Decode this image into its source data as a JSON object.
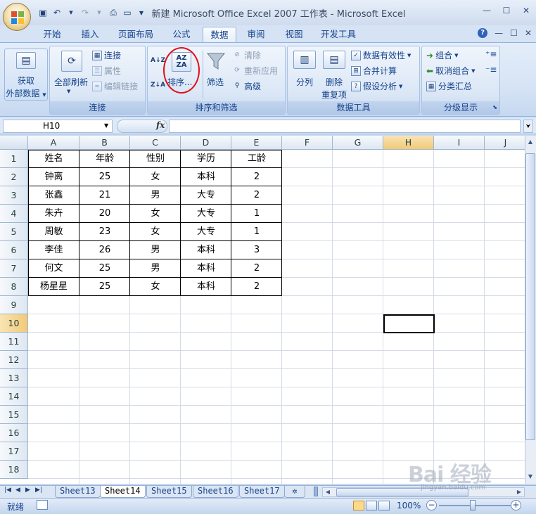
{
  "window": {
    "title": "新建 Microsoft Office Excel 2007 工作表 - Microsoft Excel",
    "minimize": "—",
    "maximize": "☐",
    "close": "✕"
  },
  "qat": [
    "save-icon",
    "undo-icon",
    "redo-icon",
    "print-preview-icon",
    "new-icon",
    "customize-icon"
  ],
  "tabs": [
    "开始",
    "插入",
    "页面布局",
    "公式",
    "数据",
    "审阅",
    "视图",
    "开发工具"
  ],
  "active_tab": "数据",
  "mdi": {
    "help": "?",
    "minimize": "—",
    "restore": "☐",
    "close": "✕"
  },
  "ribbon": {
    "get_external": {
      "label1": "获取",
      "label2": "外部数据"
    },
    "connections": {
      "refresh_all": "全部刷新",
      "connections": "连接",
      "properties": "属性",
      "edit_links": "编辑链接",
      "group_label": "连接"
    },
    "sort_filter": {
      "sort_az": "A↓Z",
      "sort_za": "Z↓A",
      "sort": "排序...",
      "filter": "筛选",
      "clear": "清除",
      "reapply": "重新应用",
      "advanced": "高级",
      "group_label": "排序和筛选"
    },
    "data_tools": {
      "text_to_columns": "分列",
      "remove_dup1": "删除",
      "remove_dup2": "重复项",
      "validation": "数据有效性",
      "consolidate": "合并计算",
      "whatif": "假设分析",
      "group_label": "数据工具"
    },
    "outline": {
      "group": "组合",
      "ungroup": "取消组合",
      "subtotal": "分类汇总",
      "group_label": "分级显示"
    }
  },
  "formula_bar": {
    "name_box": "H10",
    "fx": "fx",
    "formula": ""
  },
  "columns": [
    "A",
    "B",
    "C",
    "D",
    "E",
    "F",
    "G",
    "H",
    "I",
    "J"
  ],
  "rows": [
    "1",
    "2",
    "3",
    "4",
    "5",
    "6",
    "7",
    "8",
    "9",
    "10",
    "11",
    "12",
    "13",
    "14",
    "15",
    "16",
    "17",
    "18"
  ],
  "table": {
    "headers": [
      "姓名",
      "年龄",
      "性别",
      "学历",
      "工龄"
    ],
    "rows": [
      [
        "钟离",
        "25",
        "女",
        "本科",
        "2"
      ],
      [
        "张鑫",
        "21",
        "男",
        "大专",
        "2"
      ],
      [
        "朱卉",
        "20",
        "女",
        "大专",
        "1"
      ],
      [
        "周敏",
        "23",
        "女",
        "大专",
        "1"
      ],
      [
        "李佳",
        "26",
        "男",
        "本科",
        "3"
      ],
      [
        "何文",
        "25",
        "男",
        "本科",
        "2"
      ],
      [
        "杨星星",
        "25",
        "女",
        "本科",
        "2"
      ]
    ]
  },
  "sheets": [
    "Sheet13",
    "Sheet14",
    "Sheet15",
    "Sheet16",
    "Sheet17"
  ],
  "active_sheet": "Sheet14",
  "status": {
    "ready": "就绪",
    "zoom": "100%",
    "zoom_minus": "−",
    "zoom_plus": "+"
  },
  "watermark": {
    "text": "Bai 经验",
    "url": "jingyan.baidu.com"
  }
}
